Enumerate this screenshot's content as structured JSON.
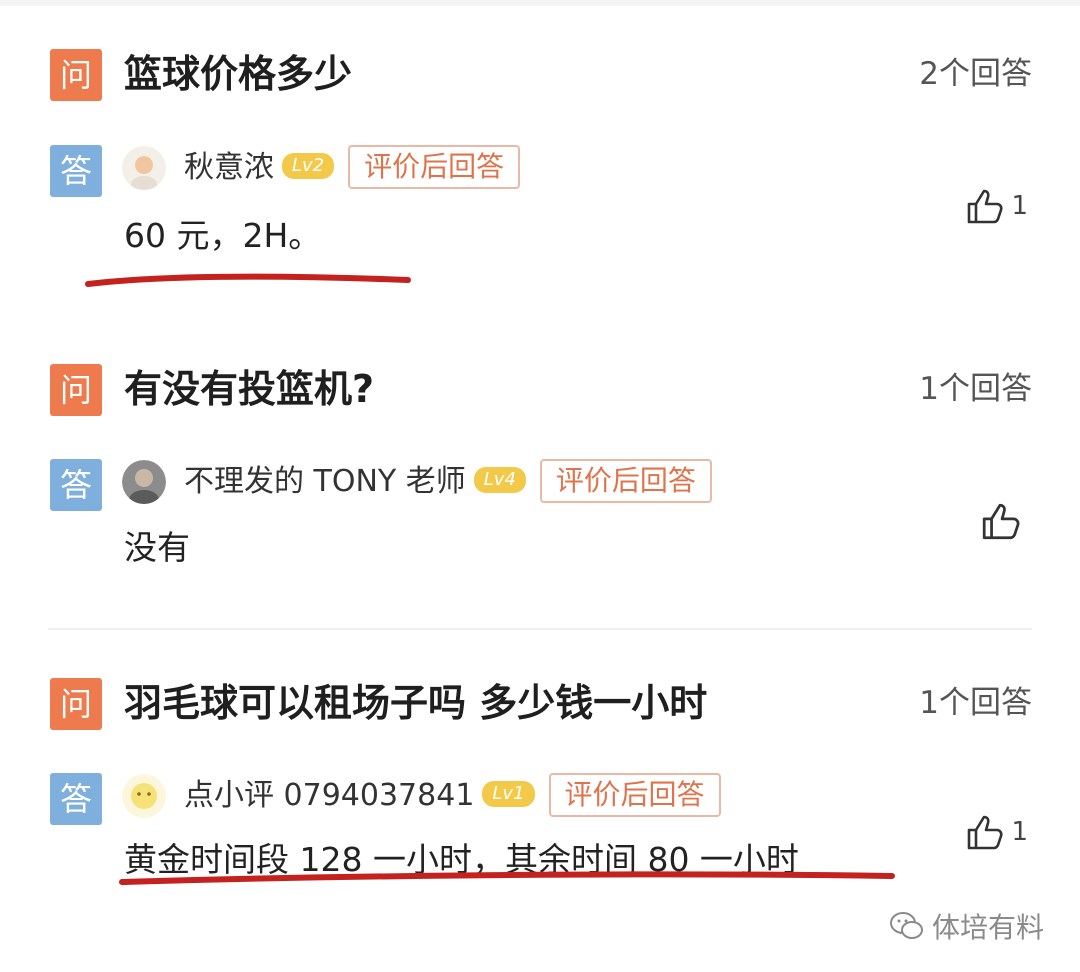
{
  "questions": [
    {
      "q_badge": "问",
      "title": "篮球价格多少",
      "answer_count": "2个回答",
      "a_badge": "答",
      "user": "秋意浓",
      "level": "Lv2",
      "rate_button": "评价后回答",
      "answer": "60 元，2H。",
      "likes": "1"
    },
    {
      "q_badge": "问",
      "title": "有没有投篮机?",
      "answer_count": "1个回答",
      "a_badge": "答",
      "user": "不理发的 TONY 老师",
      "level": "Lv4",
      "rate_button": "评价后回答",
      "answer": "没有",
      "likes": ""
    },
    {
      "q_badge": "问",
      "title": "羽毛球可以租场子吗  多少钱一小时",
      "answer_count": "1个回答",
      "a_badge": "答",
      "user": "点小评 0794037841",
      "level": "Lv1",
      "rate_button": "评价后回答",
      "answer": "黄金时间段 128 一小时，其余时间 80 一小时",
      "likes": "1"
    }
  ],
  "watermark": "体培有料",
  "colors": {
    "question_badge": "#ee7b4d",
    "answer_badge": "#7fb0dd",
    "level_badge": "#f3c94a",
    "rate_button_text": "#e0734b",
    "underline": "#c4221f"
  },
  "icons": [
    "thumbs-up-icon",
    "wechat-icon"
  ]
}
